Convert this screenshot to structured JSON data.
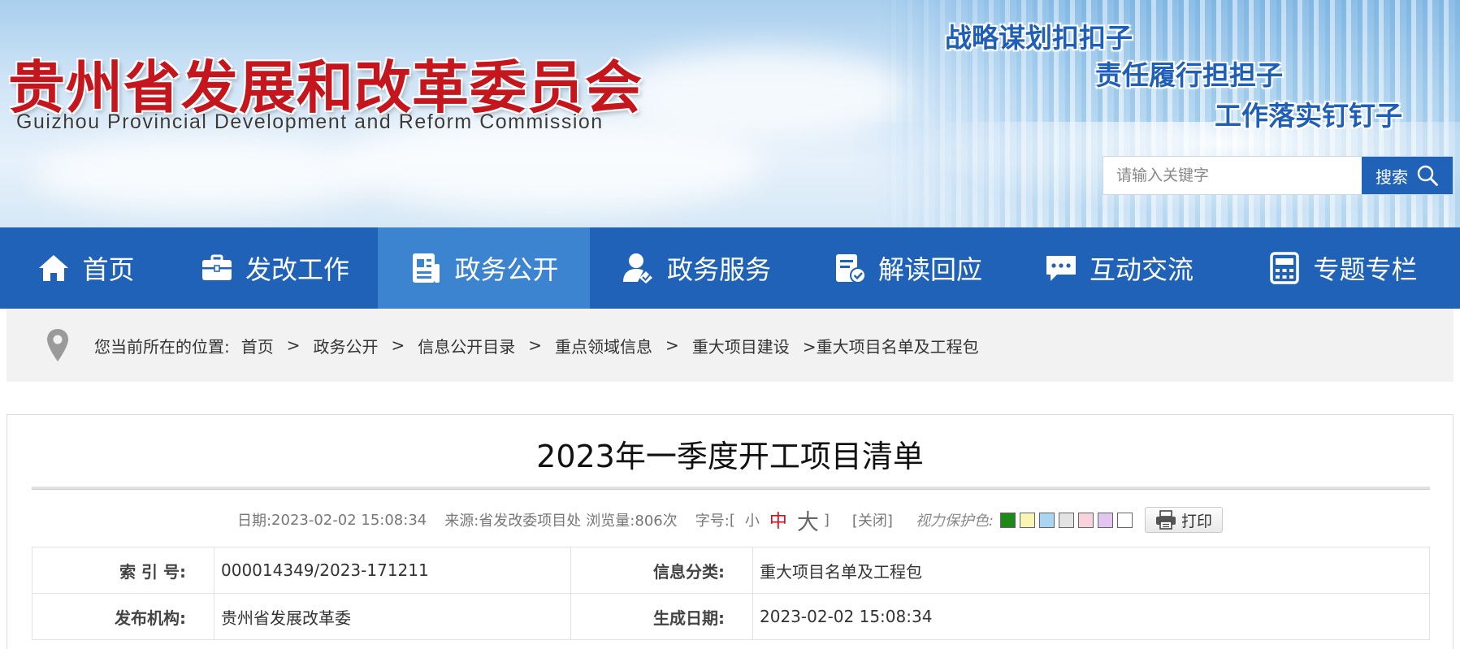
{
  "header": {
    "title": "贵州省发展和改革委员会",
    "subtitle": "Guizhou Provincial Development and Reform Commission",
    "slogans": [
      "战略谋划扣扣子",
      "责任履行担担子",
      "工作落实钉钉子"
    ]
  },
  "search": {
    "placeholder": "请输入关键字",
    "button_label": "搜索",
    "icon": "search-icon"
  },
  "nav": {
    "items": [
      {
        "label": "首页",
        "icon": "home-icon"
      },
      {
        "label": "发改工作",
        "icon": "briefcase-icon"
      },
      {
        "label": "政务公开",
        "icon": "document-icon",
        "active": true
      },
      {
        "label": "政务服务",
        "icon": "user-service-icon"
      },
      {
        "label": "解读回应",
        "icon": "clipboard-check-icon"
      },
      {
        "label": "互动交流",
        "icon": "chat-icon"
      },
      {
        "label": "专题专栏",
        "icon": "calculator-icon"
      }
    ],
    "active_color": "#3c84cf",
    "bar_color": "#1f62b8"
  },
  "breadcrumb": {
    "prefix": "您当前所在的位置:",
    "items": [
      "首页",
      "政务公开",
      "信息公开目录",
      "重点领域信息",
      "重大项目建设"
    ],
    "separator": ">",
    "current": ">重大项目名单及工程包"
  },
  "article": {
    "title": "2023年一季度开工项目清单",
    "meta": {
      "date_label": "日期:",
      "date": "2023-02-02 15:08:34",
      "source_label": "来源:",
      "source": "省发改委项目处",
      "views_label": "浏览量:",
      "views": "806次",
      "font_label": "字号:",
      "bracket_open": "[",
      "font_small": "小",
      "font_medium": "中",
      "font_large": "大",
      "bracket_close": "]",
      "close": "[关闭]",
      "eye_care_label": "视力保护色:",
      "eye_care_colors": [
        "#1d8a18",
        "#faf5b3",
        "#a8d6f2",
        "#e3e3e3",
        "#f8d2dd",
        "#e2c6ef",
        "#ffffff"
      ],
      "print_label": "打印"
    }
  },
  "info_table": {
    "rows": [
      {
        "label1": "索 引 号:",
        "value1": "000014349/2023-171211",
        "label2": "信息分类:",
        "value2": "重大项目名单及工程包"
      },
      {
        "label1": "发布机构:",
        "value1": "贵州省发展改革委",
        "label2": "生成日期:",
        "value2": "2023-02-02 15:08:34"
      }
    ]
  }
}
